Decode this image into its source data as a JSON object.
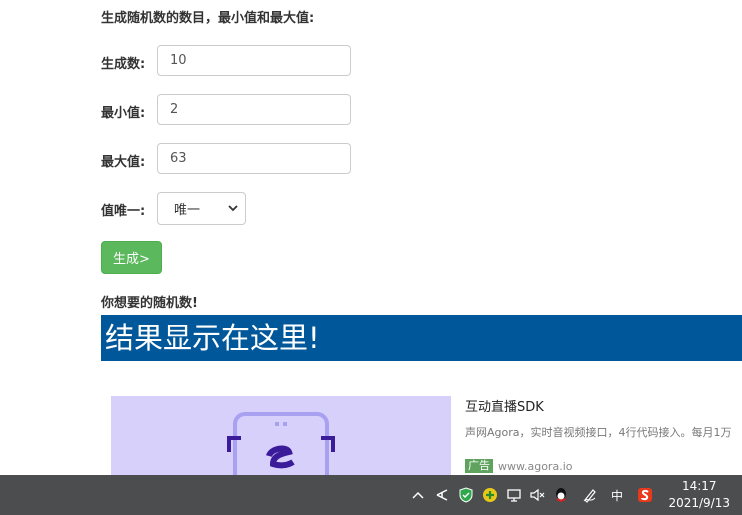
{
  "form": {
    "heading": "生成随机数的数目，最小值和最大值:",
    "count_label": "生成数:",
    "count_value": "10",
    "min_label": "最小值:",
    "min_value": "2",
    "max_label": "最大值:",
    "max_value": "63",
    "unique_label": "值唯一:",
    "unique_selected": "唯一",
    "generate_label": "生成>"
  },
  "result": {
    "heading": "你想要的随机数!",
    "text": "结果显示在这里!"
  },
  "ad": {
    "title": "互动直播SDK",
    "description": "声网Agora，实时音视频接口，4行代码接入。每月1万",
    "badge": "广告",
    "url": "www.agora.io",
    "image_bg": "#d6d0fb"
  },
  "taskbar": {
    "input_method": "中",
    "time": "14:17",
    "date": "2021/9/13",
    "icons": [
      "chevron-up-icon",
      "fork-icon",
      "shield-icon",
      "plus-icon",
      "network-icon",
      "volume-muted-icon",
      "qq-icon",
      "pen-icon",
      "ime-icon",
      "sogou-icon"
    ]
  },
  "colors": {
    "primary_button": "#5cb85c",
    "result_bar": "#00579a",
    "taskbar": "#4b4d4f"
  }
}
